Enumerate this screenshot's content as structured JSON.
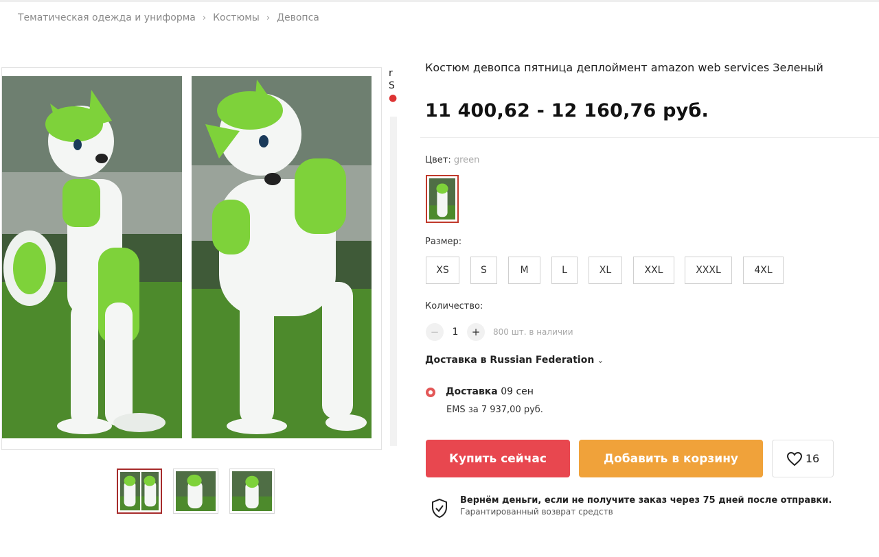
{
  "breadcrumb": [
    "Тематическая одежда и униформа",
    "Костюмы",
    "Девопса"
  ],
  "product": {
    "title": "Костюм девопса пятница деплоймент amazon web services Зеленый",
    "price": "11 400,62 - 12 160,76 руб.",
    "colors": {
      "fur_green": "#7ed23a",
      "fur_white": "#f4f6f4",
      "grass": "#4f8a2e",
      "sky": "#c9d6cf"
    }
  },
  "gallery": {
    "clipped_text": [
      "r",
      "S"
    ],
    "thumbnails": [
      "photo-1",
      "photo-2",
      "photo-3"
    ]
  },
  "options": {
    "color_label": "Цвет:",
    "color_value": "green",
    "size_label": "Размер:",
    "sizes": [
      "XS",
      "S",
      "M",
      "L",
      "XL",
      "XXL",
      "XXXL",
      "4XL"
    ],
    "quantity_label": "Количество:",
    "quantity_minus": "−",
    "quantity_value": "1",
    "quantity_plus": "+",
    "stock": "800 шт. в наличии"
  },
  "delivery": {
    "heading": "Доставка в Russian Federation",
    "chevron": "⌄",
    "label": "Доставка",
    "date": "09 сен",
    "method": "EMS за 7 937,00 руб."
  },
  "actions": {
    "buy_now": "Купить сейчас",
    "add_to_cart": "Добавить в корзину",
    "wishlist_count": "16"
  },
  "guarantee": {
    "main": "Вернём деньги, если не получите заказ через 75 дней после отправки.",
    "sub": "Гарантированный возврат средств"
  }
}
